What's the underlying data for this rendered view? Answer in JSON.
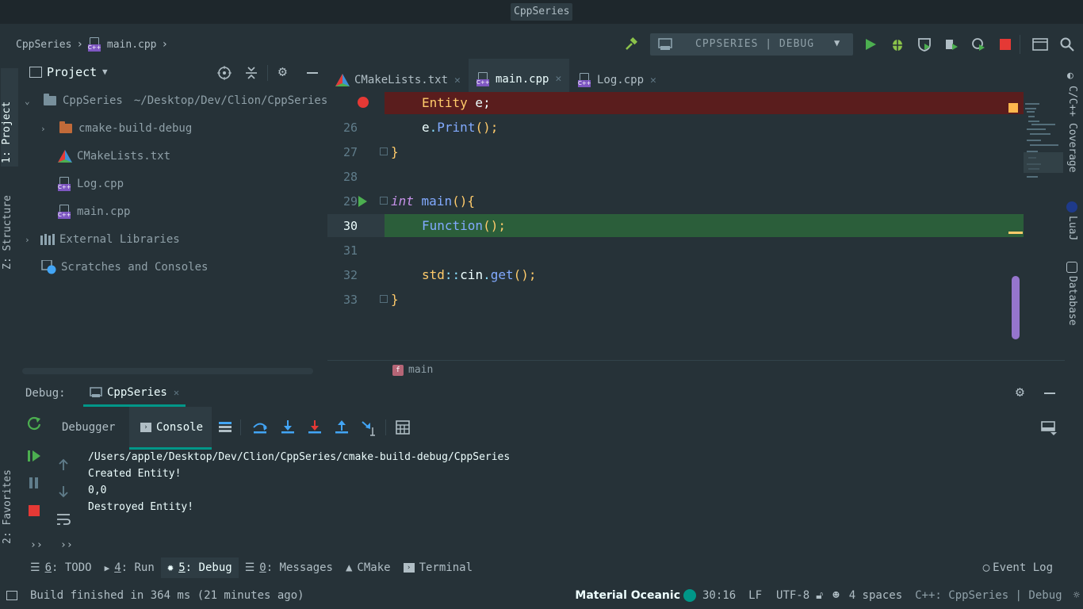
{
  "window": {
    "title": "CppSeries"
  },
  "breadcrumbs": {
    "project": "CppSeries",
    "file": "main.cpp"
  },
  "run_config": {
    "label": "CPPSERIES | DEBUG"
  },
  "toolbar_icons": [
    "hammer-icon",
    "run-icon",
    "debug-icon",
    "coverage-icon",
    "profile-icon",
    "attach-icon",
    "stop-icon",
    "layout-icon",
    "search-icon"
  ],
  "left_stripe": {
    "project_tab": "1: Project",
    "structure_tab": "Z: Structure",
    "favorites_tab": "2: Favorites"
  },
  "right_stripe": {
    "coverage_tab": "C/C++ Coverage",
    "lua_tab": "LuaJ",
    "database_tab": "Database"
  },
  "project_panel": {
    "title": "Project",
    "root": {
      "name": "CppSeries",
      "path": "~/Desktop/Dev/Clion/CppSeries"
    },
    "items": [
      {
        "label": "cmake-build-debug"
      },
      {
        "label": "CMakeLists.txt"
      },
      {
        "label": "Log.cpp"
      },
      {
        "label": "main.cpp"
      },
      {
        "label": "External Libraries"
      },
      {
        "label": "Scratches and Consoles"
      }
    ]
  },
  "editor": {
    "tabs": [
      {
        "label": "CMakeLists.txt"
      },
      {
        "label": "main.cpp"
      },
      {
        "label": "Log.cpp"
      }
    ],
    "line_numbers": [
      "26",
      "27",
      "28",
      "29",
      "30",
      "31",
      "32",
      "33"
    ],
    "code": {
      "l25_type": "Entity",
      "l25_var": " e;",
      "l26_obj": "e",
      "l26_dot": ".",
      "l26_fn": "Print",
      "l26_rest": "();",
      "l27": "}",
      "l29_kw": "int",
      "l29_fn": " main",
      "l29_rest": "(){",
      "l30_fn": "Function",
      "l30_rest": "();",
      "l32_ns": "std",
      "l32_op": "::",
      "l32_obj": "cin",
      "l32_dot": ".",
      "l32_fn": "get",
      "l32_rest": "();",
      "l33": "}"
    },
    "breadcrumb_fn": "main"
  },
  "debug": {
    "label": "Debug:",
    "session_tab": "CppSeries",
    "debugger_tab": "Debugger",
    "console_tab": "Console",
    "console_lines": [
      "/Users/apple/Desktop/Dev/Clion/CppSeries/cmake-build-debug/CppSeries",
      "Created Entity!",
      "0,0",
      "Destroyed Entity!"
    ]
  },
  "bottom_tools": {
    "todo_num": "6",
    "todo": ": TODO",
    "run_num": "4",
    "run": ": Run",
    "debug_num": "5",
    "debug": ": Debug",
    "messages_num": "0",
    "messages": ": Messages",
    "cmake": "CMake",
    "terminal": "Terminal",
    "event_log": "Event Log"
  },
  "status": {
    "message": "Build finished in 364 ms (21 minutes ago)",
    "theme": "Material Oceanic",
    "position": "30:16",
    "line_sep": "LF",
    "encoding": "UTF-8",
    "indent": "4 spaces",
    "context": "C++: CppSeries | Debug"
  },
  "colors": {
    "background": "#263238",
    "breakpoint_line": "#5A1D1D",
    "execution_line": "#2B5E3A",
    "accent": "#009688"
  }
}
